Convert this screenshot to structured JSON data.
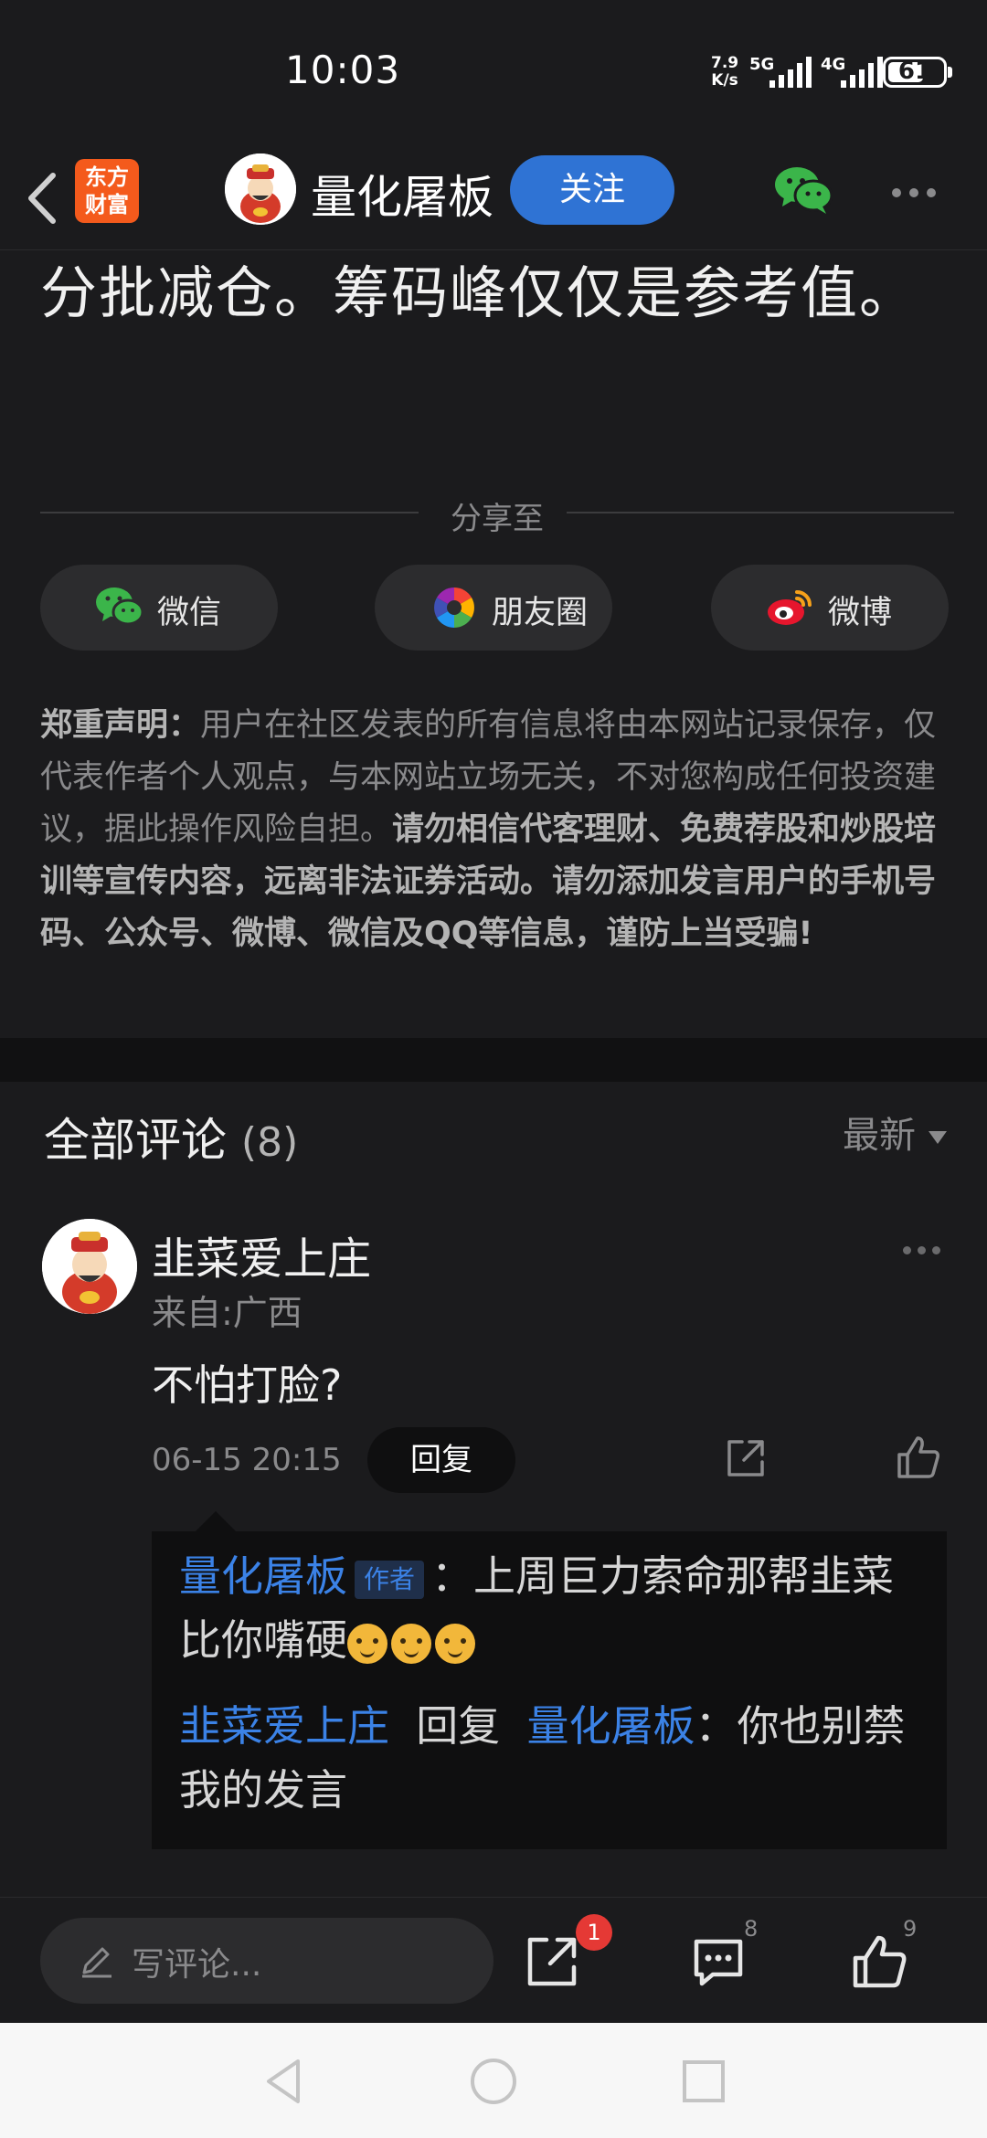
{
  "status": {
    "time": "10:03",
    "net_speed_top": "7.9",
    "net_speed_bottom": "K/s",
    "sim1": "5G",
    "sim2": "4G",
    "battery": "61"
  },
  "header": {
    "app_logo_text": "东方财富",
    "author_name": "量化屠板",
    "follow_label": "关注"
  },
  "article": {
    "last_line": "分批减仓。筹码峰仅仅是参考值。"
  },
  "share": {
    "label": "分享至",
    "buttons": [
      {
        "label": "微信",
        "icon": "wechat-icon"
      },
      {
        "label": "朋友圈",
        "icon": "moments-icon"
      },
      {
        "label": "微博",
        "icon": "weibo-icon"
      }
    ]
  },
  "disclaimer": {
    "title": "郑重声明：",
    "normal": "用户在社区发表的所有信息将由本网站记录保存，仅代表作者个人观点，与本网站立场无关，不对您构成任何投资建议，据此操作风险自担。",
    "bold": "请勿相信代客理财、免费荐股和炒股培训等宣传内容，远离非法证券活动。请勿添加发言用户的手机号码、公众号、微博、微信及QQ等信息，谨防上当受骗!"
  },
  "comments": {
    "title": "全部评论",
    "count": "(8)",
    "sort_label": "最新",
    "items": [
      {
        "user": "韭菜爱上庄",
        "location": "来自:广西",
        "text": "不怕打脸?",
        "time": "06-15 20:15",
        "reply_label": "回复",
        "replies": [
          {
            "from": "量化屠板",
            "tag": "作者",
            "sep": "：",
            "text": "上周巨力索命那帮韭菜比你嘴硬"
          },
          {
            "from": "韭菜爱上庄",
            "verb": "回复",
            "to": "量化屠板",
            "sep": "：",
            "text": "你也别禁我的发言"
          }
        ]
      }
    ]
  },
  "bottom_bar": {
    "input_placeholder": "写评论...",
    "share_badge": "1",
    "comment_count": "8",
    "like_count": "9"
  },
  "colors": {
    "background": "#1b1b1d",
    "accent_blue": "#2f73d4",
    "link_blue": "#3b82e6",
    "badge_red": "#e53935",
    "brand_orange": "#f45a1c"
  }
}
